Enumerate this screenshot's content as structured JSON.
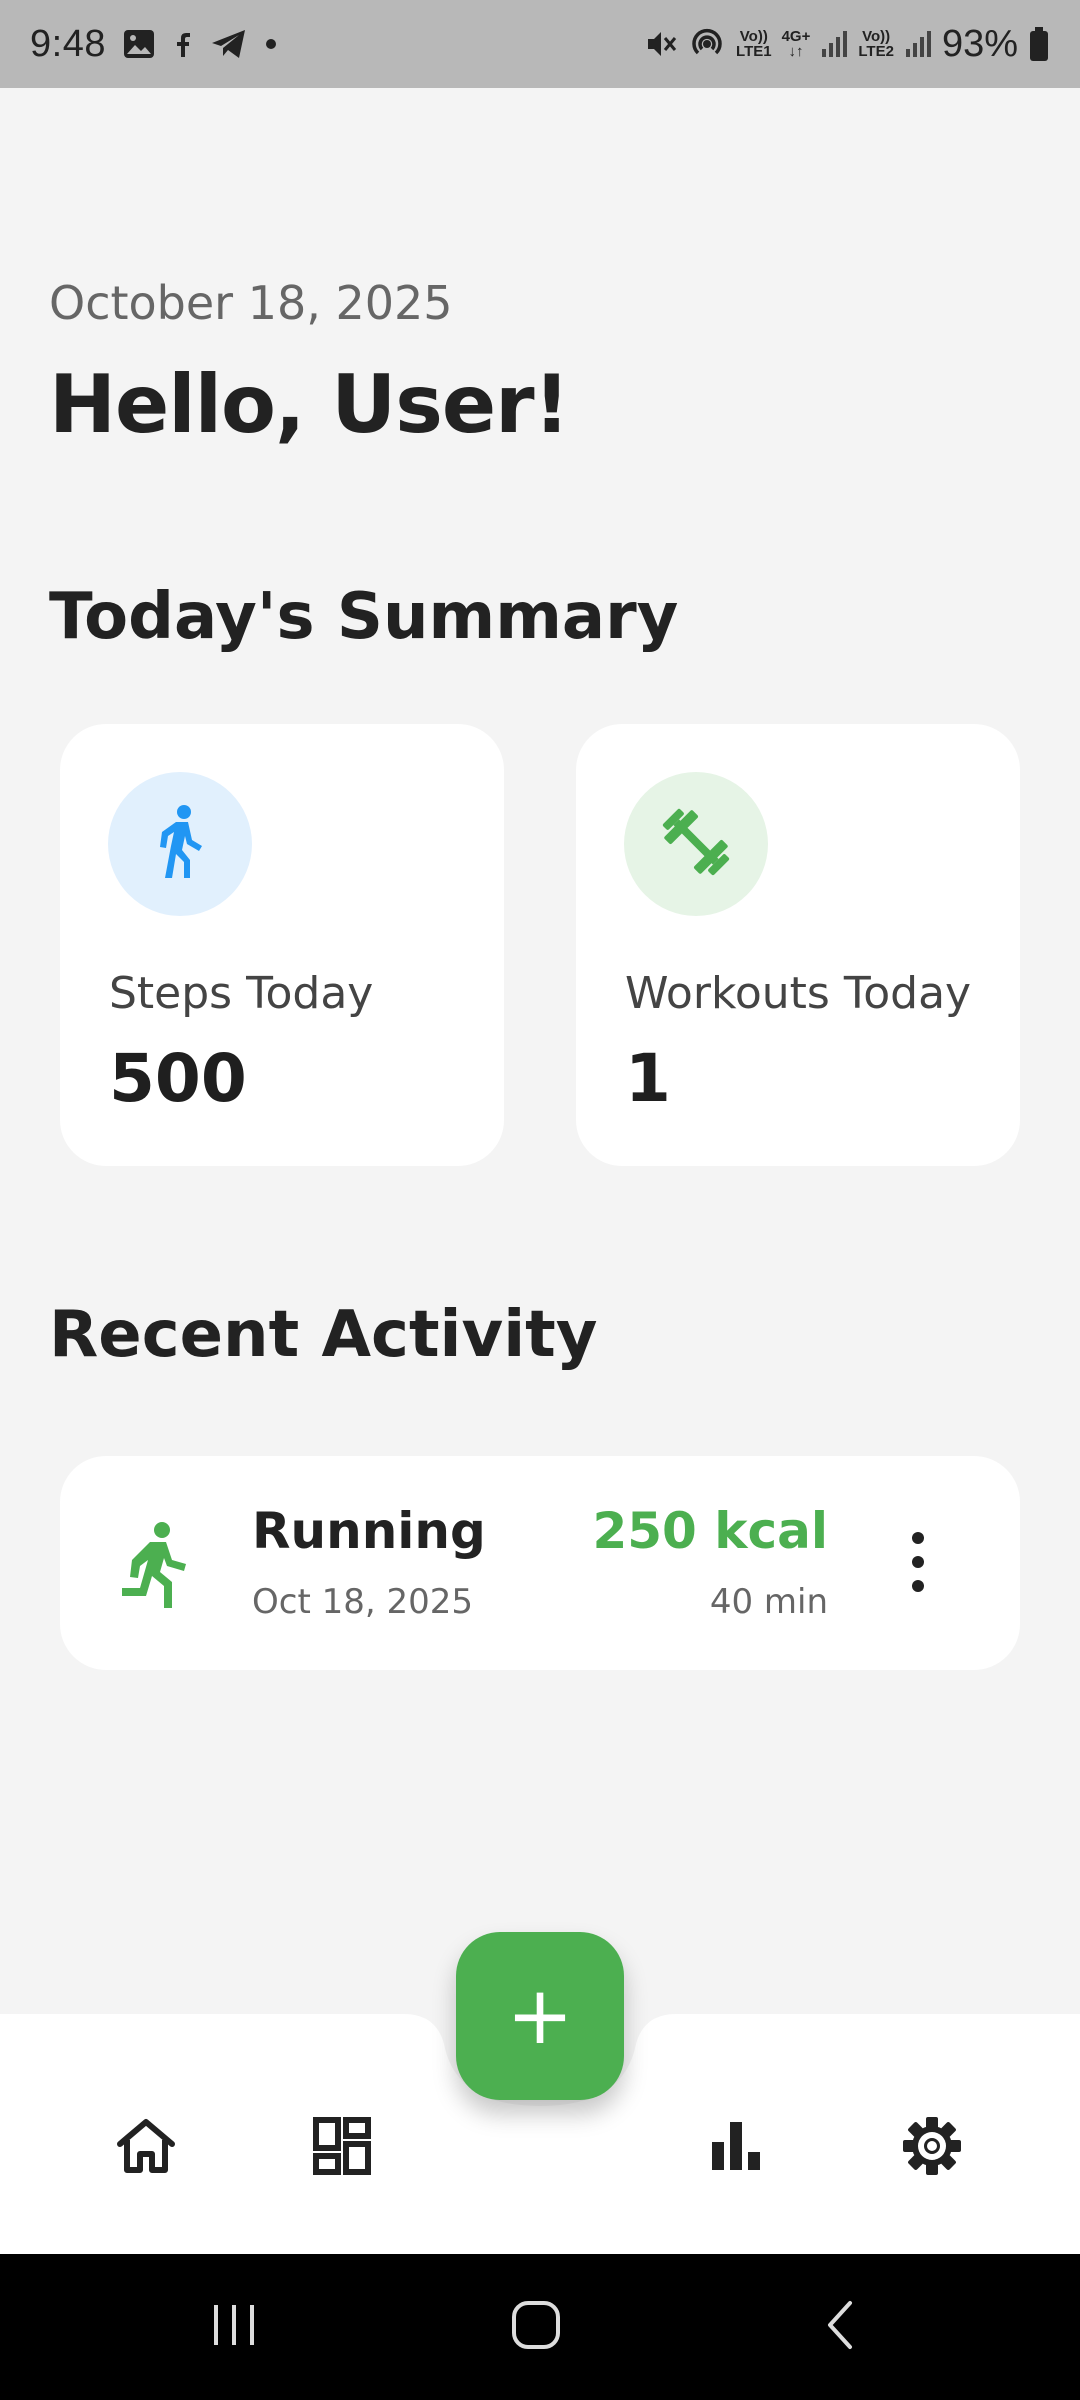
{
  "status_bar": {
    "time": "9:48",
    "lte1_top": "Vo))",
    "lte1_bottom": "LTE1",
    "net_type": "4G+",
    "lte2_top": "Vo))",
    "lte2_bottom": "LTE2",
    "battery": "93%",
    "icons": [
      "gallery-icon",
      "facebook-icon",
      "telegram-icon",
      "dot-icon",
      "mute-icon",
      "hotspot-icon",
      "signal-icon",
      "battery-icon"
    ]
  },
  "header": {
    "date": "October 18, 2025",
    "greeting": "Hello, User!"
  },
  "summary": {
    "title": "Today's Summary",
    "cards": [
      {
        "label": "Steps Today",
        "value": "500",
        "icon": "walk-icon",
        "icon_color": "#2196f3",
        "icon_bg": "#e1f0fd"
      },
      {
        "label": "Workouts Today",
        "value": "1",
        "icon": "dumbbell-icon",
        "icon_color": "#4caf50",
        "icon_bg": "#e6f4e6"
      }
    ]
  },
  "recent": {
    "title": "Recent Activity",
    "items": [
      {
        "name": "Running",
        "date": "Oct 18, 2025",
        "calories": "250 kcal",
        "duration": "40 min",
        "icon": "run-icon",
        "icon_color": "#4caf50"
      }
    ]
  },
  "fab": {
    "label": "+",
    "color": "#4caf50"
  },
  "bottom_nav": {
    "items": [
      "home-icon",
      "dashboard-icon",
      "bar-chart-icon",
      "settings-icon"
    ]
  },
  "colors": {
    "accent": "#4caf50",
    "background": "#f4f4f4",
    "card": "#ffffff"
  }
}
